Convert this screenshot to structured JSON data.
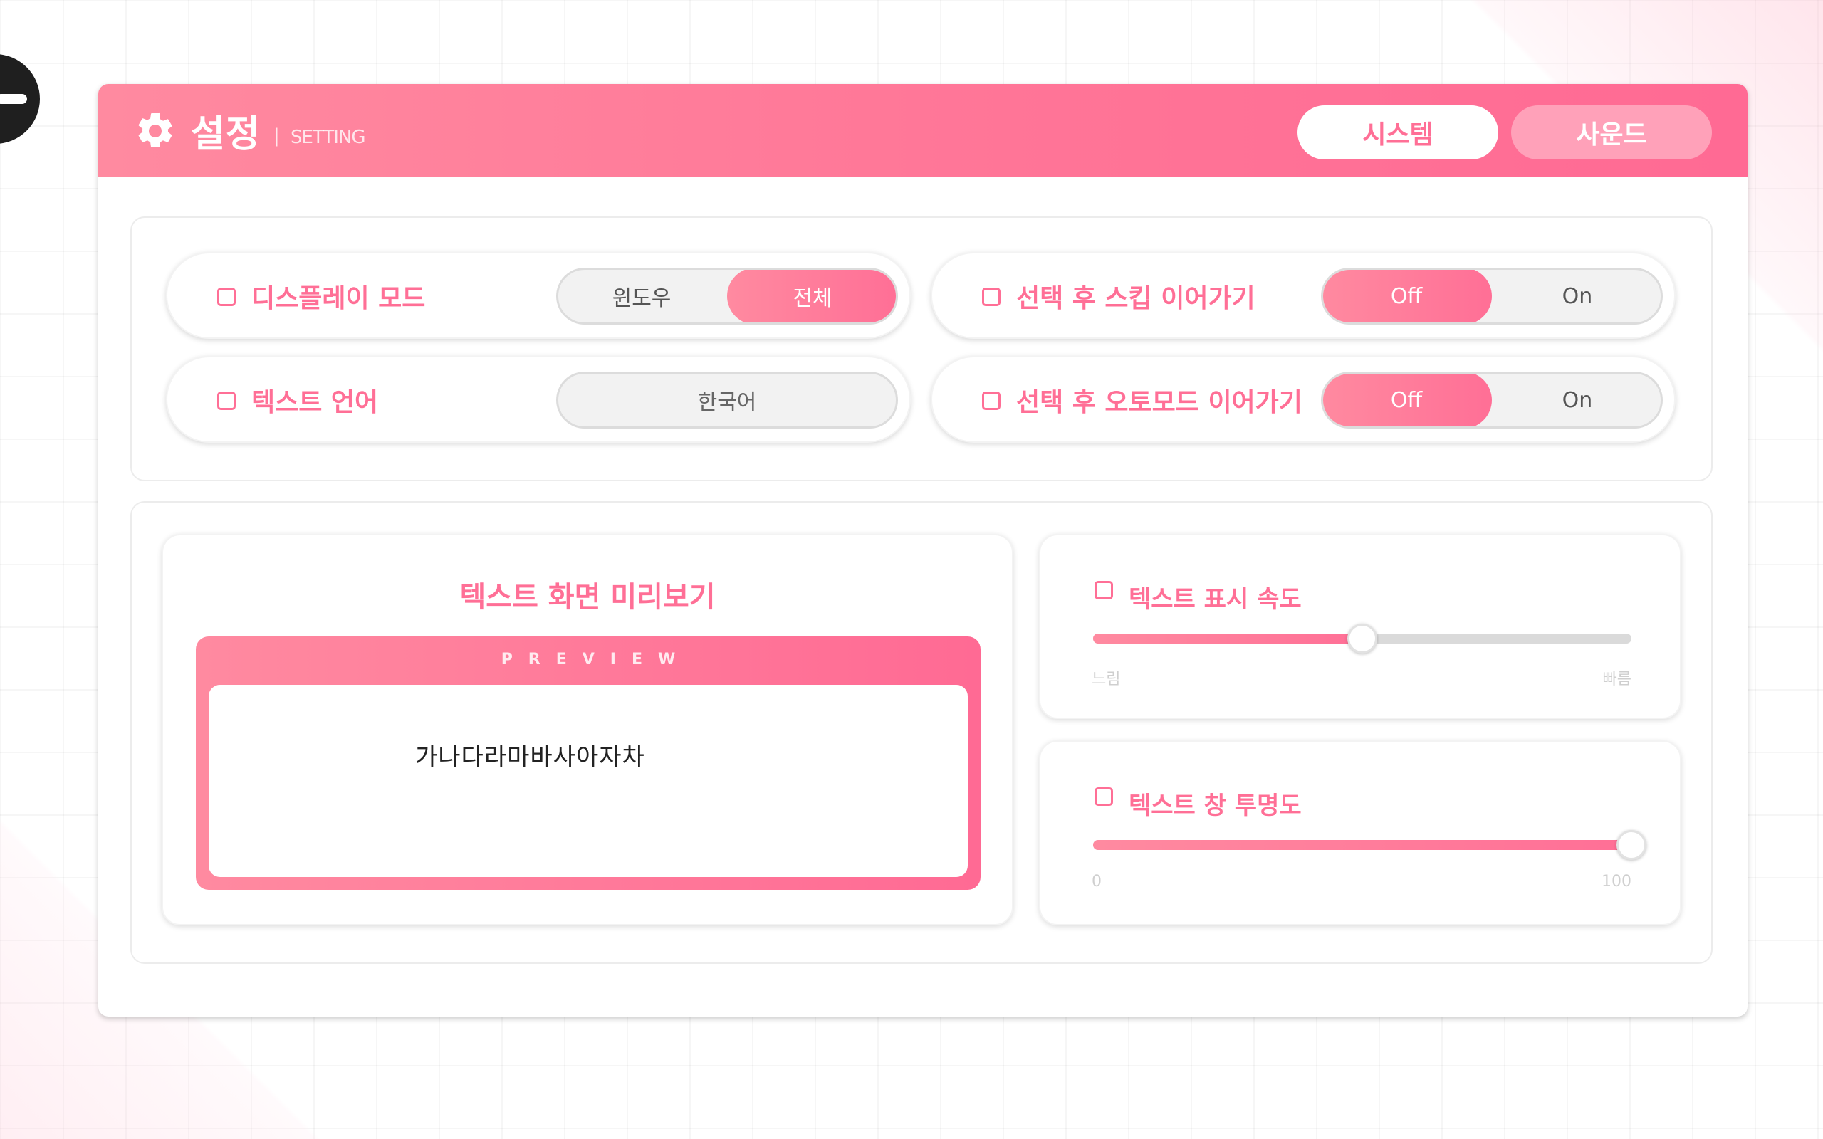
{
  "header": {
    "title": "설정",
    "separator": "|",
    "subtitle": "SETTING",
    "tabs": [
      {
        "label": "시스템",
        "active": true
      },
      {
        "label": "사운드",
        "active": false
      }
    ]
  },
  "settings": {
    "display_mode": {
      "label": "디스플레이 모드",
      "options": [
        "윈도우",
        "전체"
      ],
      "selected": "전체"
    },
    "text_language": {
      "label": "텍스트 언어",
      "value": "한국어"
    },
    "skip_after_select": {
      "label": "선택 후 스킵 이어가기",
      "options": [
        "Off",
        "On"
      ],
      "selected": "Off"
    },
    "auto_after_select": {
      "label": "선택 후 오토모드 이어가기",
      "options": [
        "Off",
        "On"
      ],
      "selected": "Off"
    }
  },
  "preview": {
    "title": "텍스트 화면 미리보기",
    "label": "PREVIEW",
    "sample_text": "가나다라마바사아자차"
  },
  "text_speed": {
    "label": "텍스트 표시 속도",
    "min_label": "느림",
    "max_label": "빠름",
    "value_fraction": 0.5
  },
  "text_opacity": {
    "label": "텍스트 창 투명도",
    "min_label": "0",
    "max_label": "100",
    "value": 100
  },
  "colors": {
    "accent": "#ff6f96",
    "accent_light": "#ff8aa0",
    "inactive_tab": "#ffa1b9"
  }
}
